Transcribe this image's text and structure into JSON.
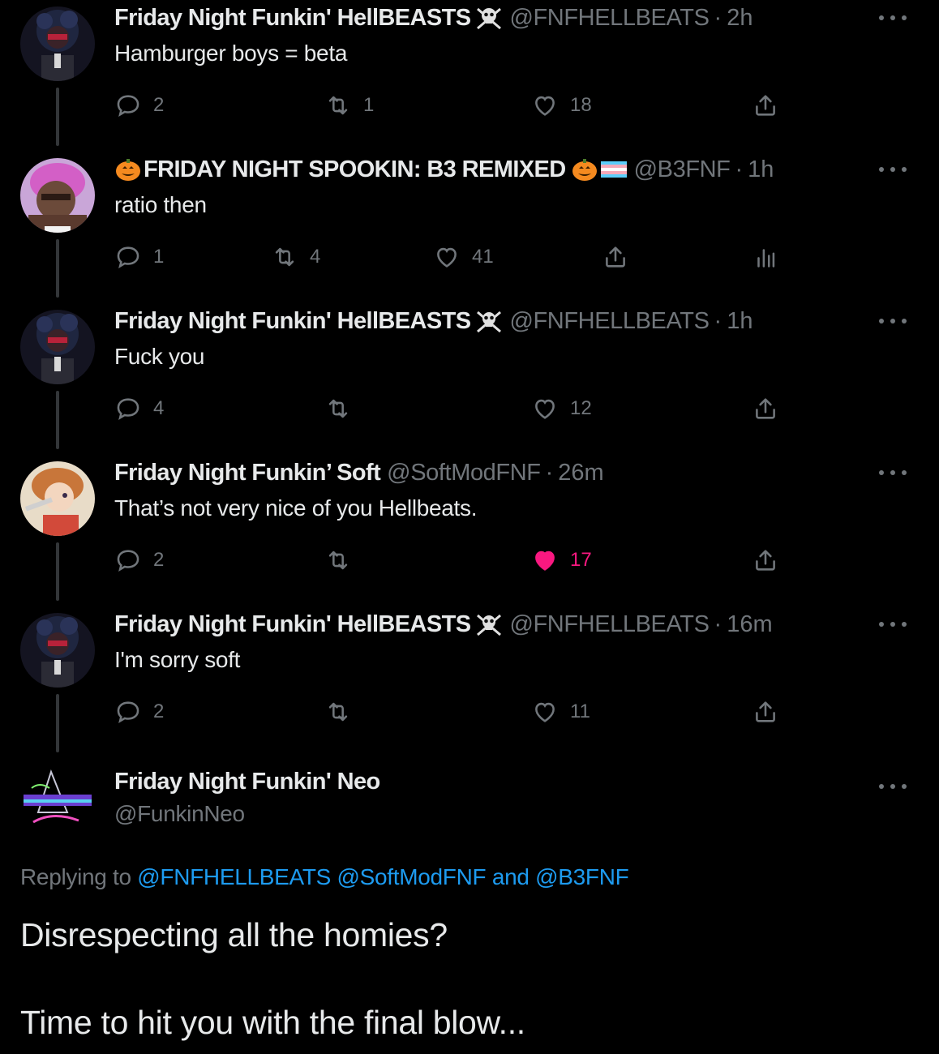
{
  "tweets": [
    {
      "name": "Friday Night Funkin' HellBEASTS",
      "name_emoji": "skull-crossbones-icon",
      "handle": "@FNFHELLBEATS",
      "time": "2h",
      "text": "Hamburger boys = beta",
      "replies": "2",
      "retweets": "1",
      "likes": "18",
      "liked": false
    },
    {
      "name_prefix_emoji": "jack-o-lantern-icon",
      "name": "FRIDAY NIGHT SPOOKIN: B3 REMIXED",
      "name_emoji": "jack-o-lantern-icon",
      "name_emoji_2": "transgender-flag-icon",
      "handle": "@B3FNF",
      "time": "1h",
      "text": "ratio then",
      "replies": "1",
      "retweets": "4",
      "likes": "41",
      "liked": false
    },
    {
      "name": "Friday Night Funkin' HellBEASTS",
      "name_emoji": "skull-crossbones-icon",
      "handle": "@FNFHELLBEATS",
      "time": "1h",
      "text": "Fuck you",
      "replies": "4",
      "retweets": "",
      "likes": "12",
      "liked": false
    },
    {
      "name": "Friday Night Funkin’ Soft",
      "handle": "@SoftModFNF",
      "time": "26m",
      "text": "That’s not very nice of you Hellbeats.",
      "replies": "2",
      "retweets": "",
      "likes": "17",
      "liked": true
    },
    {
      "name": "Friday Night Funkin' HellBEASTS",
      "name_emoji": "skull-crossbones-icon",
      "handle": "@FNFHELLBEATS",
      "time": "16m",
      "text": "I'm sorry soft",
      "replies": "2",
      "retweets": "",
      "likes": "11",
      "liked": false
    }
  ],
  "separator": "·",
  "main_tweet": {
    "name": "Friday Night Funkin' Neo",
    "handle": "@FunkinNeo",
    "replying_label": "Replying to",
    "mentions": [
      "@FNFHELLBEATS",
      "@SoftModFNF",
      "@B3FNF"
    ],
    "and_label": "and",
    "line1": "Disrespecting all the homies?",
    "line2": "Time to hit you with the final blow..."
  },
  "colors": {
    "background": "#000000",
    "text": "#e7e9ea",
    "muted": "#71767b",
    "link": "#1d9bf0",
    "like": "#f91880"
  }
}
